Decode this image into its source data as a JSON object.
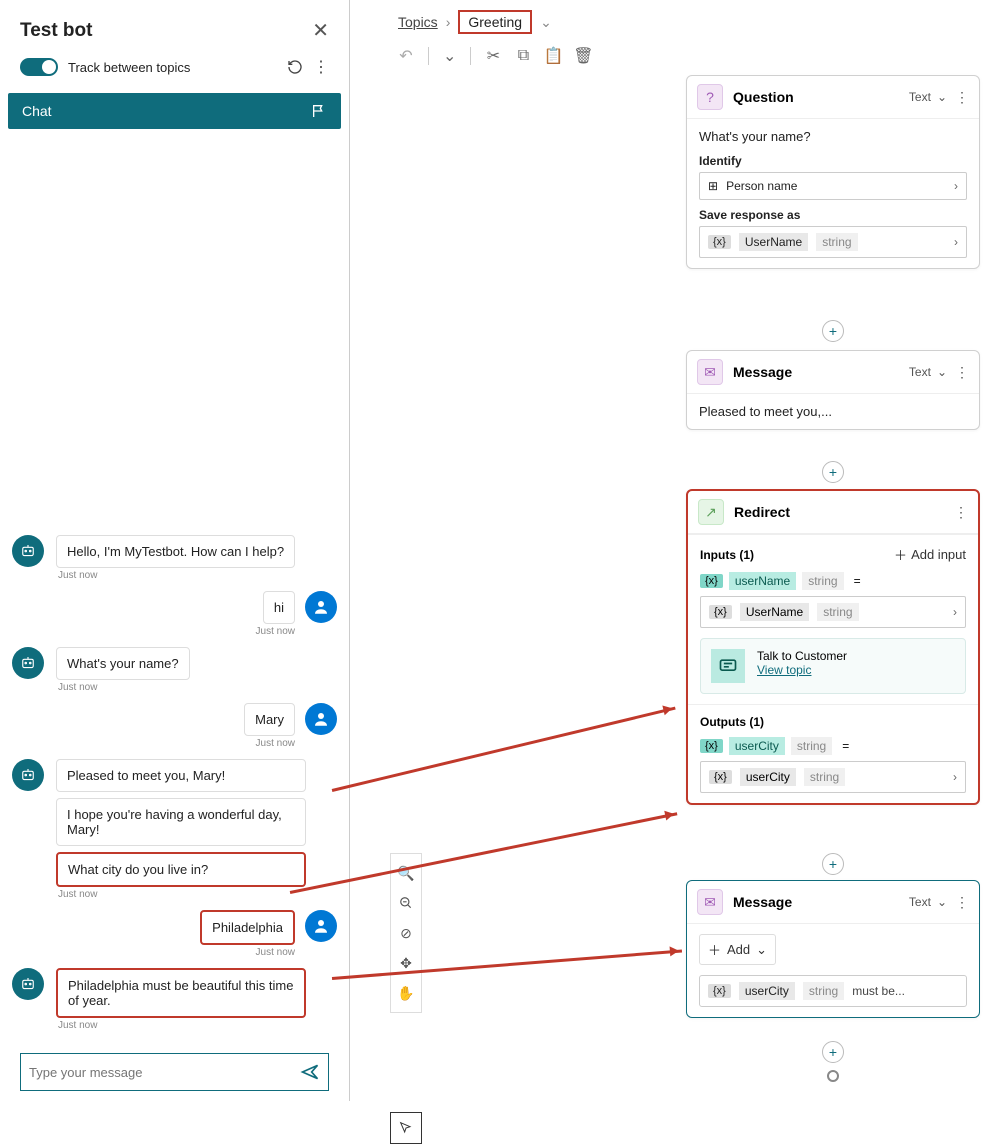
{
  "left": {
    "title": "Test bot",
    "track_label": "Track between topics",
    "chat_label": "Chat",
    "input_placeholder": "Type your message"
  },
  "chat": {
    "m1": "Hello, I'm MyTestbot. How can I help?",
    "t1": "Just now",
    "u1": "hi",
    "tu1": "Just now",
    "m2": "What's your name?",
    "t2": "Just now",
    "u2": "Mary",
    "tu2": "Just now",
    "m3a": "Pleased to meet you, Mary!",
    "m3b": "I hope you're having a wonderful day, Mary!",
    "m3c": "What city do you live in?",
    "t3": "Just now",
    "u3": "Philadelphia",
    "tu3": "Just now",
    "m4": "Philadelphia must be beautiful this time of year.",
    "t4": "Just now"
  },
  "bc": {
    "topics": "Topics",
    "current": "Greeting"
  },
  "q": {
    "title": "Question",
    "mode": "Text",
    "prompt": "What's your name?",
    "identify_label": "Identify",
    "identify_value": "Person name",
    "save_label": "Save response as",
    "var_name": "UserName",
    "var_type": "string"
  },
  "m1": {
    "title": "Message",
    "mode": "Text",
    "text": "Pleased to meet you,..."
  },
  "r": {
    "title": "Redirect",
    "inputs_label": "Inputs (1)",
    "add_input": "Add input",
    "in_var": "userName",
    "in_type": "string",
    "in_val": "UserName",
    "in_val_type": "string",
    "topic_name": "Talk to Customer",
    "topic_link": "View topic",
    "outputs_label": "Outputs (1)",
    "out_var": "userCity",
    "out_type": "string",
    "out_val": "userCity",
    "out_val_type": "string"
  },
  "m2": {
    "title": "Message",
    "mode": "Text",
    "add": "Add",
    "var": "userCity",
    "vtype": "string",
    "tail": "must be..."
  }
}
